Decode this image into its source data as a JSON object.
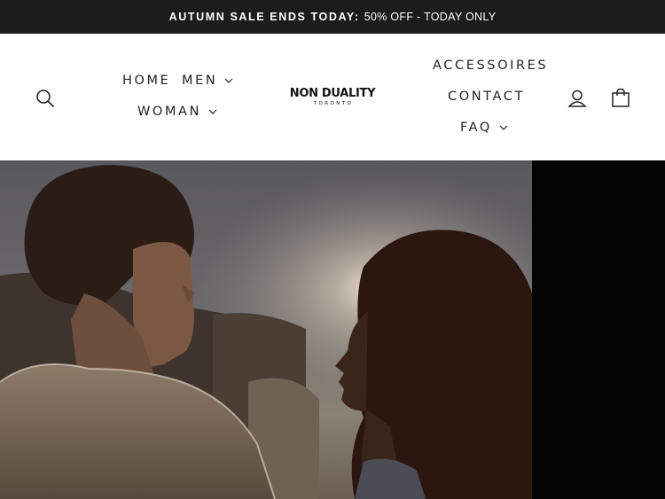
{
  "announcement": {
    "strong_text": "AUTUMN SALE ENDS TODAY:",
    "rest_text": "50% OFF - TODAY ONLY"
  },
  "logo": {
    "name": "NON DUALITY",
    "subtitle": "TORONTO"
  },
  "nav": {
    "home": "HOME",
    "men": "MEN",
    "woman": "WOMAN",
    "accessoires": "ACCESSOIRES",
    "contact": "CONTACT",
    "faq": "FAQ"
  },
  "icons": {
    "search": "search-icon",
    "account": "user-icon",
    "cart": "bag-icon",
    "dropdown": "chevron-down-icon"
  },
  "colors": {
    "announcement_bg": "#1c1c1c",
    "header_bg": "#ffffff",
    "text": "#222222",
    "hero_bg": "#040404"
  }
}
